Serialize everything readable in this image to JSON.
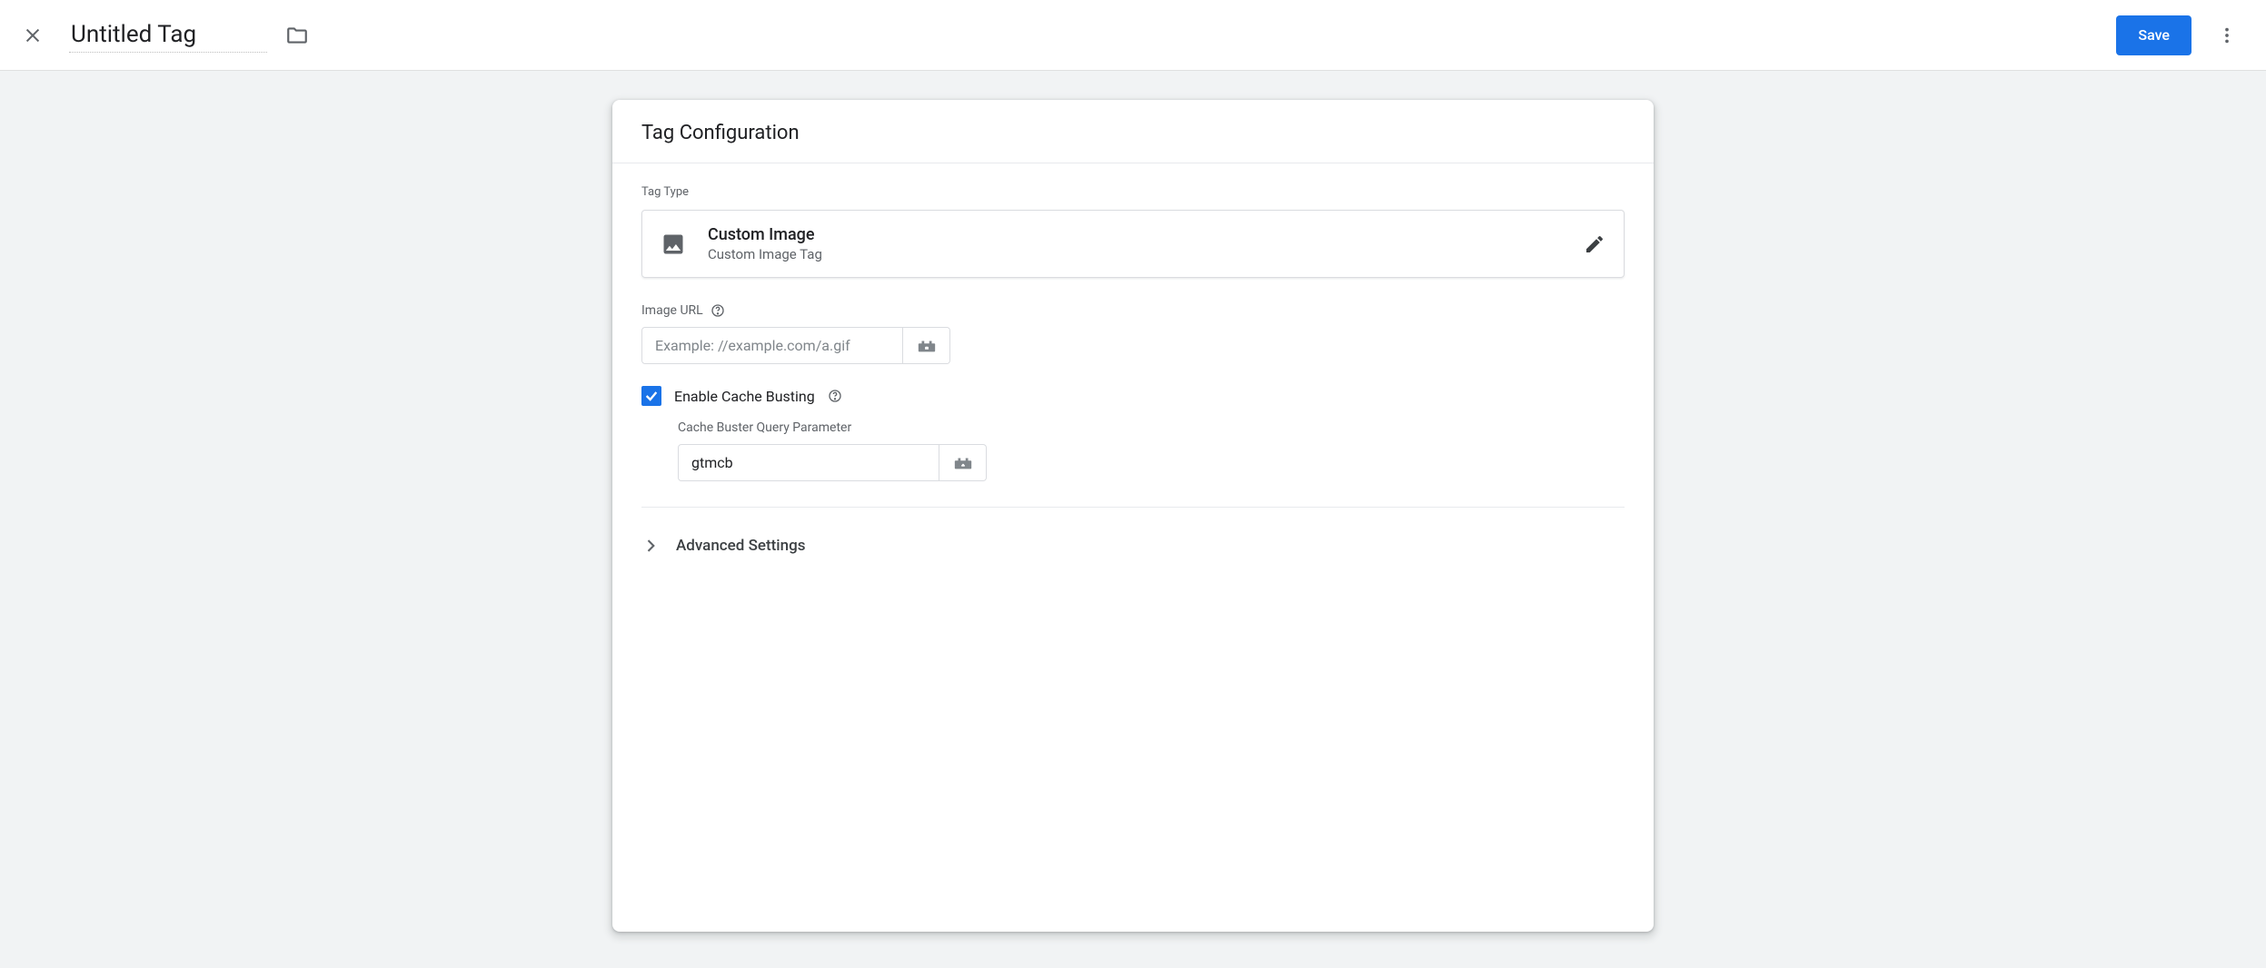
{
  "header": {
    "title_value": "Untitled Tag",
    "save_label": "Save"
  },
  "card": {
    "title": "Tag Configuration",
    "tag_type_label": "Tag Type",
    "tag_type": {
      "name": "Custom Image",
      "sub": "Custom Image Tag"
    },
    "image_url": {
      "label": "Image URL",
      "placeholder": "Example: //example.com/a.gif",
      "value": ""
    },
    "cache_busting": {
      "label": "Enable Cache Busting",
      "checked": true,
      "param_label": "Cache Buster Query Parameter",
      "param_value": "gtmcb"
    },
    "advanced_label": "Advanced Settings"
  }
}
